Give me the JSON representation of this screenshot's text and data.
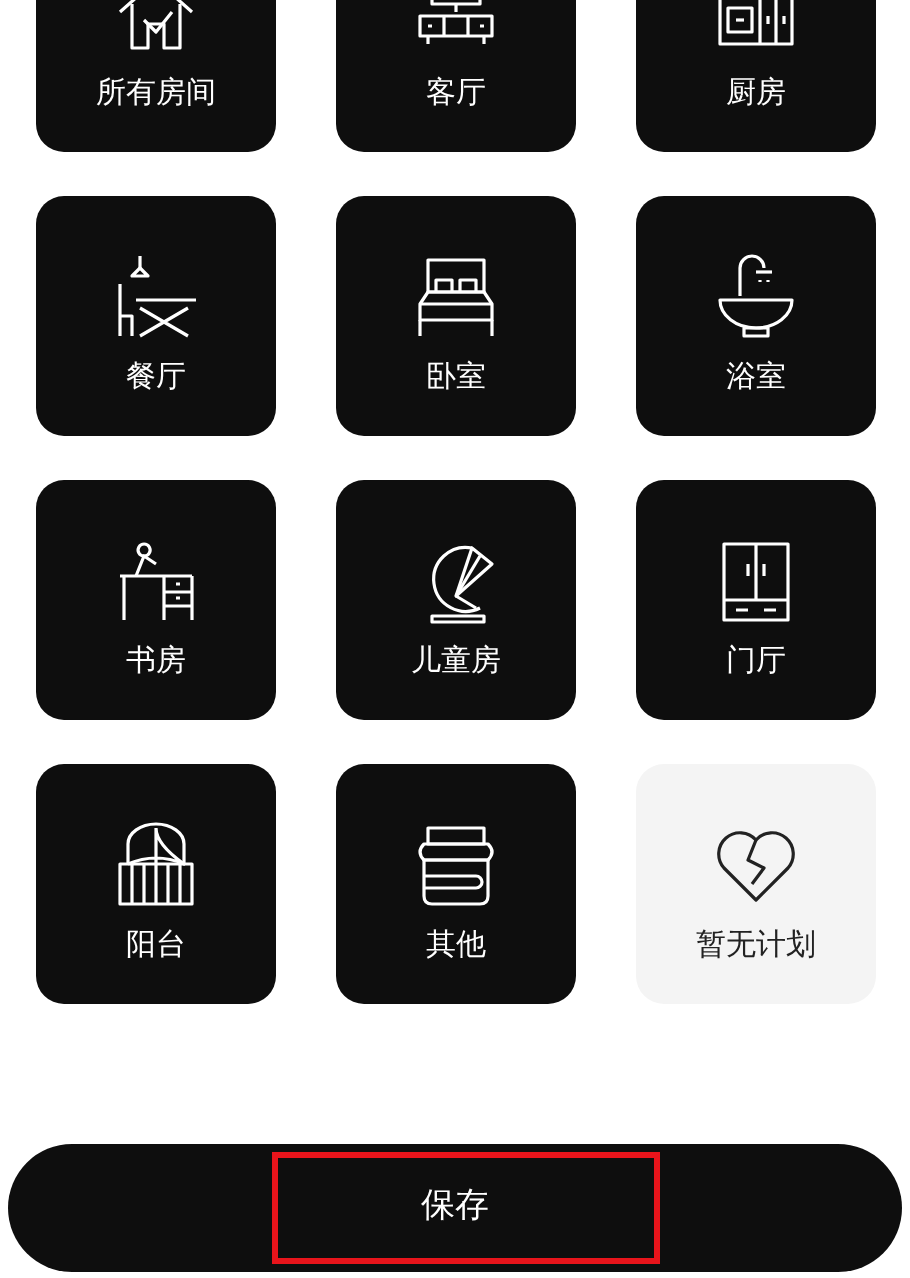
{
  "rooms": [
    {
      "label": "所有房间",
      "kind": "house",
      "selected": false
    },
    {
      "label": "客厅",
      "kind": "tv",
      "selected": false
    },
    {
      "label": "厨房",
      "kind": "kitchen",
      "selected": false
    },
    {
      "label": "餐厅",
      "kind": "dining",
      "selected": false
    },
    {
      "label": "卧室",
      "kind": "bed",
      "selected": false
    },
    {
      "label": "浴室",
      "kind": "bath",
      "selected": false
    },
    {
      "label": "书房",
      "kind": "desk",
      "selected": false
    },
    {
      "label": "儿童房",
      "kind": "kidchair",
      "selected": false
    },
    {
      "label": "门厅",
      "kind": "wardrobe",
      "selected": false
    },
    {
      "label": "阳台",
      "kind": "balcony",
      "selected": false
    },
    {
      "label": "其他",
      "kind": "bedding",
      "selected": false
    },
    {
      "label": "暂无计划",
      "kind": "heart",
      "selected": true
    }
  ],
  "save_button": {
    "label": "保存",
    "highlighted": true
  }
}
